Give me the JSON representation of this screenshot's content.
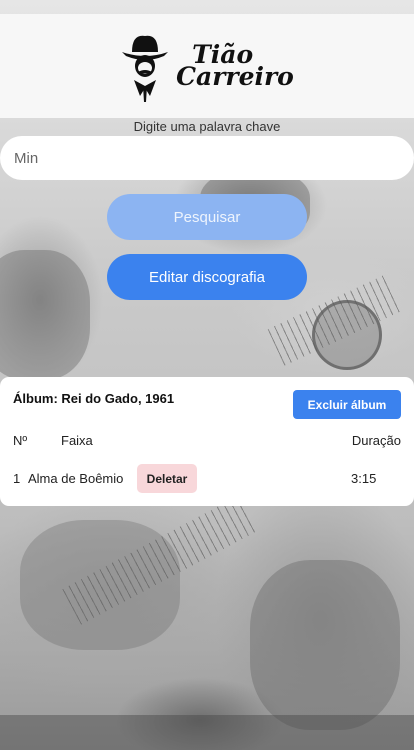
{
  "header": {
    "logo_line1": "Tião",
    "logo_line2": "Carreiro",
    "logo_icon": "cowboy-hat-figure-icon"
  },
  "search": {
    "label": "Digite uma palavra chave",
    "value": "Min",
    "button_label": "Pesquisar"
  },
  "edit_button_label": "Editar discografia",
  "album": {
    "title": "Álbum: Rei do Gado, 1961",
    "delete_button_label": "Excluir álbum",
    "columns": {
      "number": "Nº",
      "track": "Faixa",
      "duration": "Duração"
    },
    "tracks": [
      {
        "number": "1",
        "name": "Alma de Boêmio",
        "delete_label": "Deletar",
        "duration": "3:15"
      }
    ]
  },
  "colors": {
    "primary": "#3b82ee",
    "primary_disabled": "#8cb4f2",
    "delete_badge": "#f8d7da"
  }
}
